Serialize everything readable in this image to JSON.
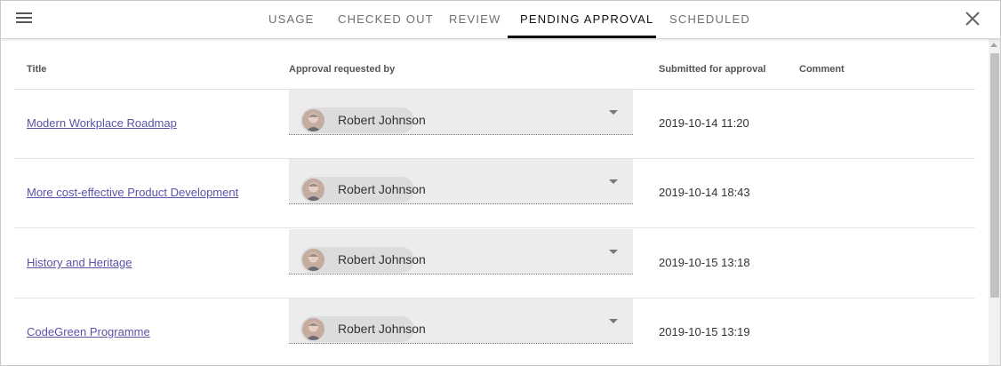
{
  "header": {
    "tabs": [
      {
        "label": "USAGE"
      },
      {
        "label": "CHECKED OUT"
      },
      {
        "label": "REVIEW"
      },
      {
        "label": "PENDING APPROVAL"
      },
      {
        "label": "SCHEDULED"
      }
    ],
    "active_tab": "PENDING APPROVAL",
    "menu_icon": "hamburger-menu-icon",
    "close_icon": "close-icon"
  },
  "table": {
    "columns": {
      "title": "Title",
      "requested_by": "Approval requested by",
      "submitted": "Submitted for approval",
      "comment": "Comment"
    },
    "rows": [
      {
        "title": "Modern Workplace Roadmap",
        "requested_by": "Robert Johnson",
        "submitted": "2019-10-14 11:20",
        "comment": ""
      },
      {
        "title": "More cost-effective Product Development",
        "requested_by": "Robert Johnson",
        "submitted": "2019-10-14 18:43",
        "comment": ""
      },
      {
        "title": "History and Heritage",
        "requested_by": "Robert Johnson",
        "submitted": "2019-10-15 13:18",
        "comment": ""
      },
      {
        "title": "CodeGreen Programme",
        "requested_by": "Robert Johnson",
        "submitted": "2019-10-15 13:19",
        "comment": ""
      }
    ]
  },
  "colors": {
    "link": "#5a53a8",
    "active_tab": "#111111",
    "inactive_tab": "#6f6f6f",
    "select_bg": "#ececec"
  }
}
